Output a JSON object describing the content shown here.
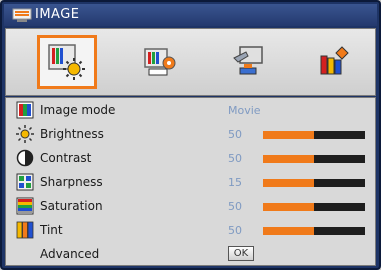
{
  "window": {
    "title": "IMAGE"
  },
  "tabs": [
    {
      "name": "image",
      "icon": "image-settings-icon",
      "selected": true
    },
    {
      "name": "display",
      "icon": "display-settings-icon",
      "selected": false
    },
    {
      "name": "setup",
      "icon": "setup-icon",
      "selected": false
    },
    {
      "name": "options",
      "icon": "options-icon",
      "selected": false
    }
  ],
  "settings": [
    {
      "label": "Image mode",
      "value": "Movie",
      "icon": "image-mode-icon"
    },
    {
      "label": "Brightness",
      "value": "50",
      "level": 0.5,
      "icon": "brightness-icon"
    },
    {
      "label": "Contrast",
      "value": "50",
      "level": 0.5,
      "icon": "contrast-icon"
    },
    {
      "label": "Sharpness",
      "value": "15",
      "level": 0.5,
      "icon": "sharpness-icon"
    },
    {
      "label": "Saturation",
      "value": "50",
      "level": 0.5,
      "icon": "saturation-icon"
    },
    {
      "label": "Tint",
      "value": "50",
      "level": 0.5,
      "icon": "tint-icon"
    },
    {
      "label": "Advanced",
      "button": "OK"
    }
  ],
  "colors": {
    "accent": "#f07a1a",
    "frame": "#1e3466",
    "value_text": "#7f9ac2"
  }
}
